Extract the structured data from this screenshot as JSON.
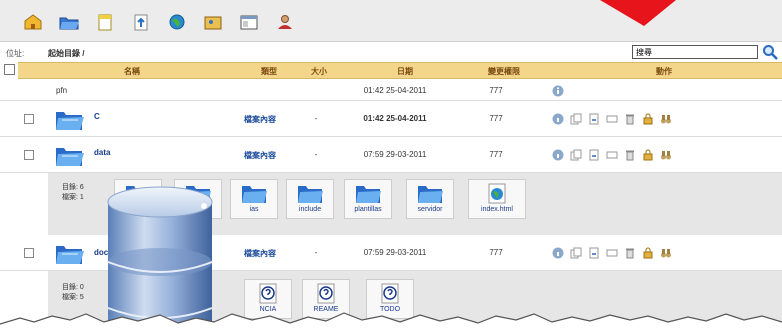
{
  "toolbar": {
    "icons": [
      "home-icon",
      "folder-open-icon",
      "new-document-icon",
      "upload-icon",
      "globe-icon",
      "image-folder-icon",
      "window-icon",
      "user-icon"
    ]
  },
  "path": {
    "label": "位址:",
    "value": "起始目錄 /"
  },
  "search": {
    "value": "搜尋"
  },
  "table": {
    "headers": {
      "name": "名稱",
      "type": "類型",
      "size": "大小",
      "date": "日期",
      "perms": "變更權限",
      "actions": "動作"
    },
    "rows": [
      {
        "name": "pfn",
        "type": "",
        "size": "",
        "date": "01:42 25-04-2011",
        "perms": "777"
      },
      {
        "name": "C",
        "type": "檔案內容",
        "size": "-",
        "date": "01:42 25-04-2011",
        "perms": "777"
      },
      {
        "name": "data",
        "type": "檔案內容",
        "size": "-",
        "date": "07:59 29-03-2011",
        "perms": "777"
      },
      {
        "name": "doc",
        "type": "檔案內容",
        "size": "-",
        "date": "07:59 29-03-2011",
        "perms": "777"
      }
    ]
  },
  "preview1": {
    "count_dirs": "目錄: 6",
    "count_files": "檔案: 1",
    "items": [
      "",
      "",
      "ias",
      "include",
      "plantillas",
      "servidor",
      "index.html"
    ]
  },
  "preview2": {
    "count_dirs": "目錄: 0",
    "count_files": "檔案: 5",
    "items": [
      "NCIA",
      "REAME",
      "TODO"
    ]
  },
  "colors": {
    "header_bg": "#f3d68a",
    "accent": "#1a3a88",
    "flag": "#e8141c"
  }
}
